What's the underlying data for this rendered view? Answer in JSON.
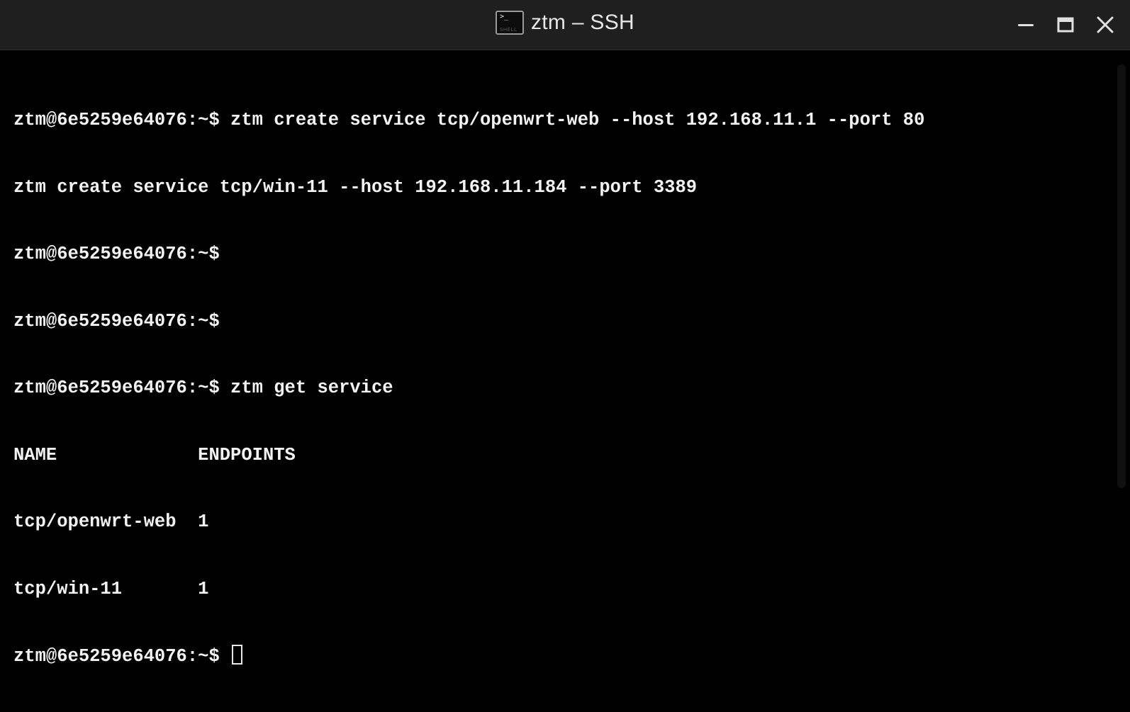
{
  "window": {
    "title": "ztm – SSH",
    "icon": "terminal-icon",
    "icon_prompt": ">_",
    "icon_label": "SHELL",
    "controls": [
      "minimize",
      "maximize",
      "close"
    ]
  },
  "terminal": {
    "lines": [
      "ztm@6e5259e64076:~$ ztm create service tcp/openwrt-web --host 192.168.11.1 --port 80",
      "ztm create service tcp/win-11 --host 192.168.11.184 --port 3389",
      "ztm@6e5259e64076:~$",
      "ztm@6e5259e64076:~$",
      "ztm@6e5259e64076:~$ ztm get service",
      "NAME             ENDPOINTS",
      "tcp/openwrt-web  1",
      "tcp/win-11       1"
    ],
    "prompt": "ztm@6e5259e64076:~$ "
  },
  "colors": {
    "titlebar": "#1f1f1f",
    "background": "#000000",
    "text": "#f2f2f2"
  }
}
